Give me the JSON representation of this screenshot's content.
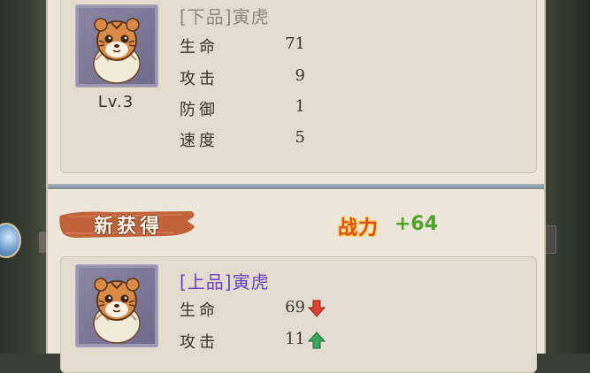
{
  "current_pet": {
    "name": "[下品]寅虎",
    "level": "Lv.3",
    "stats": [
      {
        "label": "生命",
        "value": "71"
      },
      {
        "label": "攻击",
        "value": "9"
      },
      {
        "label": "防御",
        "value": "1"
      },
      {
        "label": "速度",
        "value": "5"
      }
    ]
  },
  "new_section": {
    "banner_label": "新获得",
    "power_label": "战力",
    "power_change": "+64"
  },
  "new_pet": {
    "name": "[上品]寅虎",
    "stats": [
      {
        "label": "生命",
        "value": "69",
        "trend": "down",
        "trend_color": "#d9442f"
      },
      {
        "label": "攻击",
        "value": "11",
        "trend": "up",
        "trend_color": "#3aa55e"
      }
    ]
  },
  "colors": {
    "panel_bg": "#ebe6d8",
    "common_name": "#8b877e",
    "rare_name": "#6b3fbf",
    "power_positive": "#4fa32a"
  }
}
